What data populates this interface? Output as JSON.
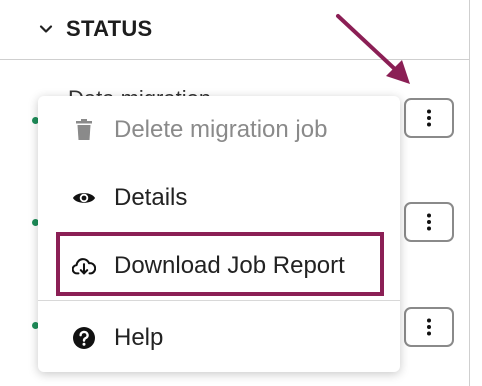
{
  "section": {
    "title": "STATUS"
  },
  "row": {
    "partial_label": "Data migration"
  },
  "menu": {
    "items": [
      {
        "label": "Delete migration job",
        "icon": "trash-icon",
        "disabled": true
      },
      {
        "label": "Details",
        "icon": "eye-icon",
        "disabled": false
      },
      {
        "label": "Download Job Report",
        "icon": "cloud-download-icon",
        "disabled": false,
        "highlighted": true
      },
      {
        "label": "Help",
        "icon": "help-circle-icon",
        "disabled": false
      }
    ]
  },
  "colors": {
    "highlight": "#8b1f55",
    "arrow": "#8b1f55",
    "status_dot": "#1e8e5a"
  }
}
